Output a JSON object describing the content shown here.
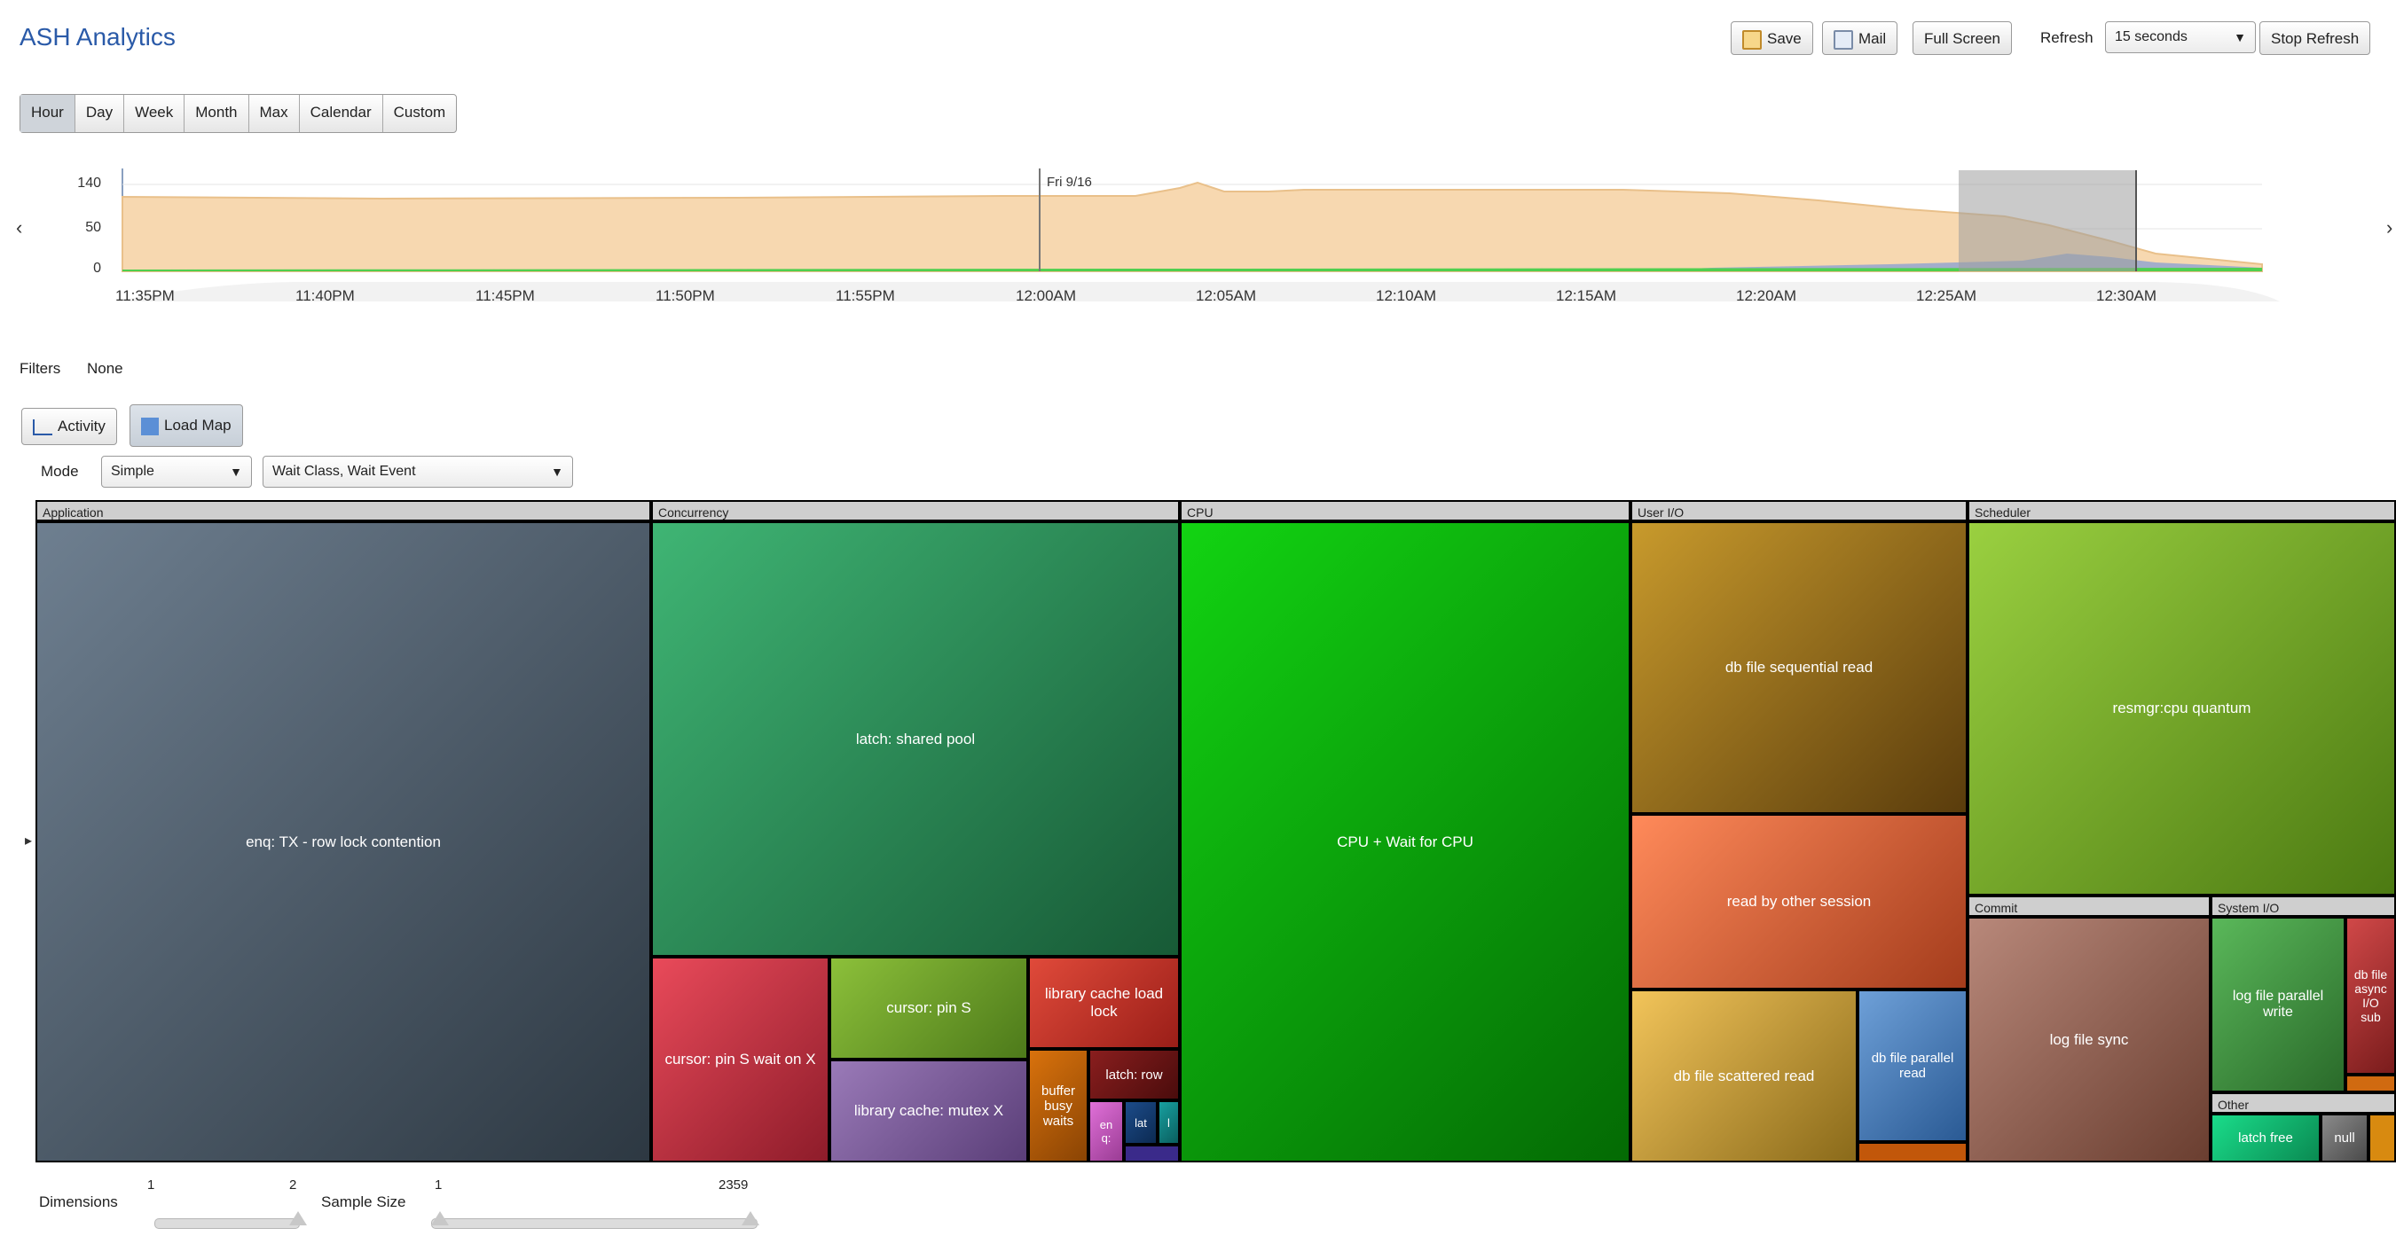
{
  "app": {
    "title": "ASH Analytics"
  },
  "toolbar": {
    "save": "Save",
    "mail": "Mail",
    "full_screen": "Full Screen",
    "refresh_label": "Refresh",
    "refresh_value": "15 seconds",
    "stop_refresh": "Stop Refresh"
  },
  "tabs": [
    {
      "label": "Hour",
      "active": true
    },
    {
      "label": "Day"
    },
    {
      "label": "Week"
    },
    {
      "label": "Month"
    },
    {
      "label": "Max"
    },
    {
      "label": "Calendar"
    },
    {
      "label": "Custom"
    }
  ],
  "range_chart": {
    "y_ticks": [
      "140",
      "50",
      "0"
    ],
    "x_ticks": [
      "11:35PM",
      "11:40PM",
      "11:45PM",
      "11:50PM",
      "11:55PM",
      "12:00AM",
      "12:05AM",
      "12:10AM",
      "12:15AM",
      "12:20AM",
      "12:25AM",
      "12:30AM"
    ],
    "marker_label": "Fri 9/16",
    "selection_window": [
      "12:25AM",
      "12:30AM"
    ]
  },
  "filters": {
    "label": "Filters",
    "value": "None"
  },
  "view_tabs": [
    {
      "label": "Activity"
    },
    {
      "label": "Load Map",
      "active": true
    }
  ],
  "mode": {
    "label": "Mode",
    "value": "Simple",
    "dimension_value": "Wait Class, Wait Event"
  },
  "treemap": {
    "groups": [
      {
        "name": "Application",
        "cells": [
          {
            "label": "enq: TX - row lock contention"
          }
        ]
      },
      {
        "name": "Concurrency",
        "cells": [
          {
            "label": "latch: shared pool"
          },
          {
            "label": "cursor: pin S wait on X"
          },
          {
            "label": "cursor: pin S"
          },
          {
            "label": "library cache load lock"
          },
          {
            "label": "library cache: mutex X"
          },
          {
            "label": "buffer busy waits"
          },
          {
            "label": "latch: row"
          },
          {
            "label": "en q:"
          },
          {
            "label": "lat"
          },
          {
            "label": "l"
          }
        ]
      },
      {
        "name": "CPU",
        "cells": [
          {
            "label": "CPU + Wait for CPU"
          }
        ]
      },
      {
        "name": "User I/O",
        "cells": [
          {
            "label": "db file sequential read"
          },
          {
            "label": "read by other session"
          },
          {
            "label": "db file scattered read"
          },
          {
            "label": "db file parallel read"
          }
        ]
      },
      {
        "name": "Scheduler",
        "cells": [
          {
            "label": "resmgr:cpu quantum"
          }
        ]
      },
      {
        "name": "Commit",
        "cells": [
          {
            "label": "log file sync"
          }
        ]
      },
      {
        "name": "System I/O",
        "cells": [
          {
            "label": "log file parallel write"
          },
          {
            "label": "db file async I/O sub"
          }
        ]
      },
      {
        "name": "Other",
        "cells": [
          {
            "label": "latch free"
          },
          {
            "label": "null"
          }
        ]
      }
    ]
  },
  "dimensions": {
    "label": "Dimensions",
    "min": "1",
    "max": "2"
  },
  "sample_size": {
    "label": "Sample Size",
    "min": "1",
    "max": "2359"
  },
  "colors": {
    "application": "#3e4b58",
    "concurrency": "#2e7d52",
    "cpu": "#0a9a12",
    "user_io": "#8a6a1c",
    "scheduler": "#6fa62a",
    "commit": "#8a5a4a"
  }
}
